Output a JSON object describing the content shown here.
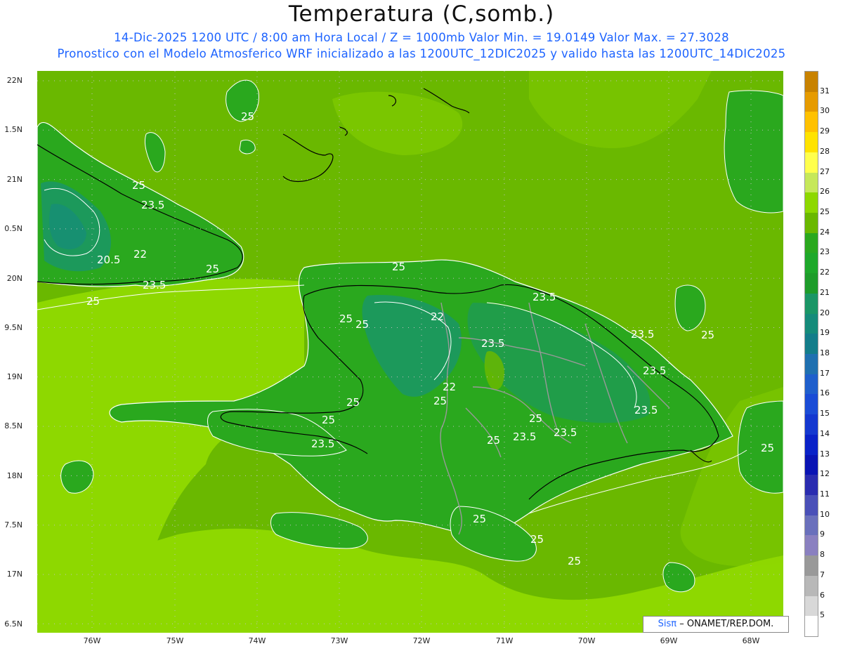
{
  "title": "Temperatura (C,somb.)",
  "subtitle1": "14-Dic-2025  1200 UTC / 8:00 am Hora Local / Z = 1000mb   Valor Min. = 19.0149  Valor Max. = 27.3028",
  "subtitle2": "Pronostico con el Modelo Atmosferico WRF inicializado a las 1200UTC_12DIC2025 y valido hasta las  1200UTC_14DIC2025",
  "lat_labels": [
    "22N",
    "1.5N",
    "21N",
    "0.5N",
    "20N",
    "9.5N",
    "19N",
    "8.5N",
    "18N",
    "7.5N",
    "17N",
    "6.5N"
  ],
  "lon_labels": [
    "76W",
    "75W",
    "74W",
    "73W",
    "72W",
    "71W",
    "70W",
    "69W",
    "68W"
  ],
  "colorbar_labels": [
    "31",
    "30",
    "29",
    "28",
    "27",
    "26",
    "25",
    "24",
    "23",
    "22",
    "21",
    "20",
    "19",
    "18",
    "17",
    "16",
    "15",
    "14",
    "13",
    "12",
    "11",
    "10",
    "9",
    "8",
    "7",
    "6",
    "5"
  ],
  "colorbar_colors": [
    "#c88200",
    "#e69b00",
    "#ffc100",
    "#ffe300",
    "#ffff4d",
    "#c6e85a",
    "#8ed800",
    "#6ab800",
    "#2aa81e",
    "#1ea82a",
    "#1e9c2a",
    "#1a9666",
    "#158b7a",
    "#137d8a",
    "#1f70b0",
    "#1f5fcc",
    "#1a4cd6",
    "#1438d0",
    "#0a22c8",
    "#0a14b4",
    "#2a2cb0",
    "#4a50b8",
    "#6a70bc",
    "#8a80c0",
    "#999999",
    "#b8b8b8",
    "#d8d8d8",
    "#ffffff"
  ],
  "contour_labels": [
    "25",
    "25",
    "23.5",
    "20.5",
    "22",
    "23.5",
    "25",
    "25",
    "25",
    "23.5",
    "25",
    "22",
    "23.5",
    "23.5",
    "22",
    "23.5",
    "25",
    "25",
    "25",
    "23.5",
    "25",
    "23.5",
    "23.5",
    "25",
    "25",
    "23.5",
    "25",
    "25",
    "25",
    "25",
    "25"
  ],
  "credit": {
    "sis": "Sisπ",
    "rest": "– ONAMET/REP.DOM."
  },
  "colors": {
    "ocean_light": "#8ed800",
    "ocean_mid": "#6ab800",
    "land_green": "#2aa81e",
    "land_dark": "#1a9666",
    "coast": "#000000",
    "border": "#999999"
  }
}
